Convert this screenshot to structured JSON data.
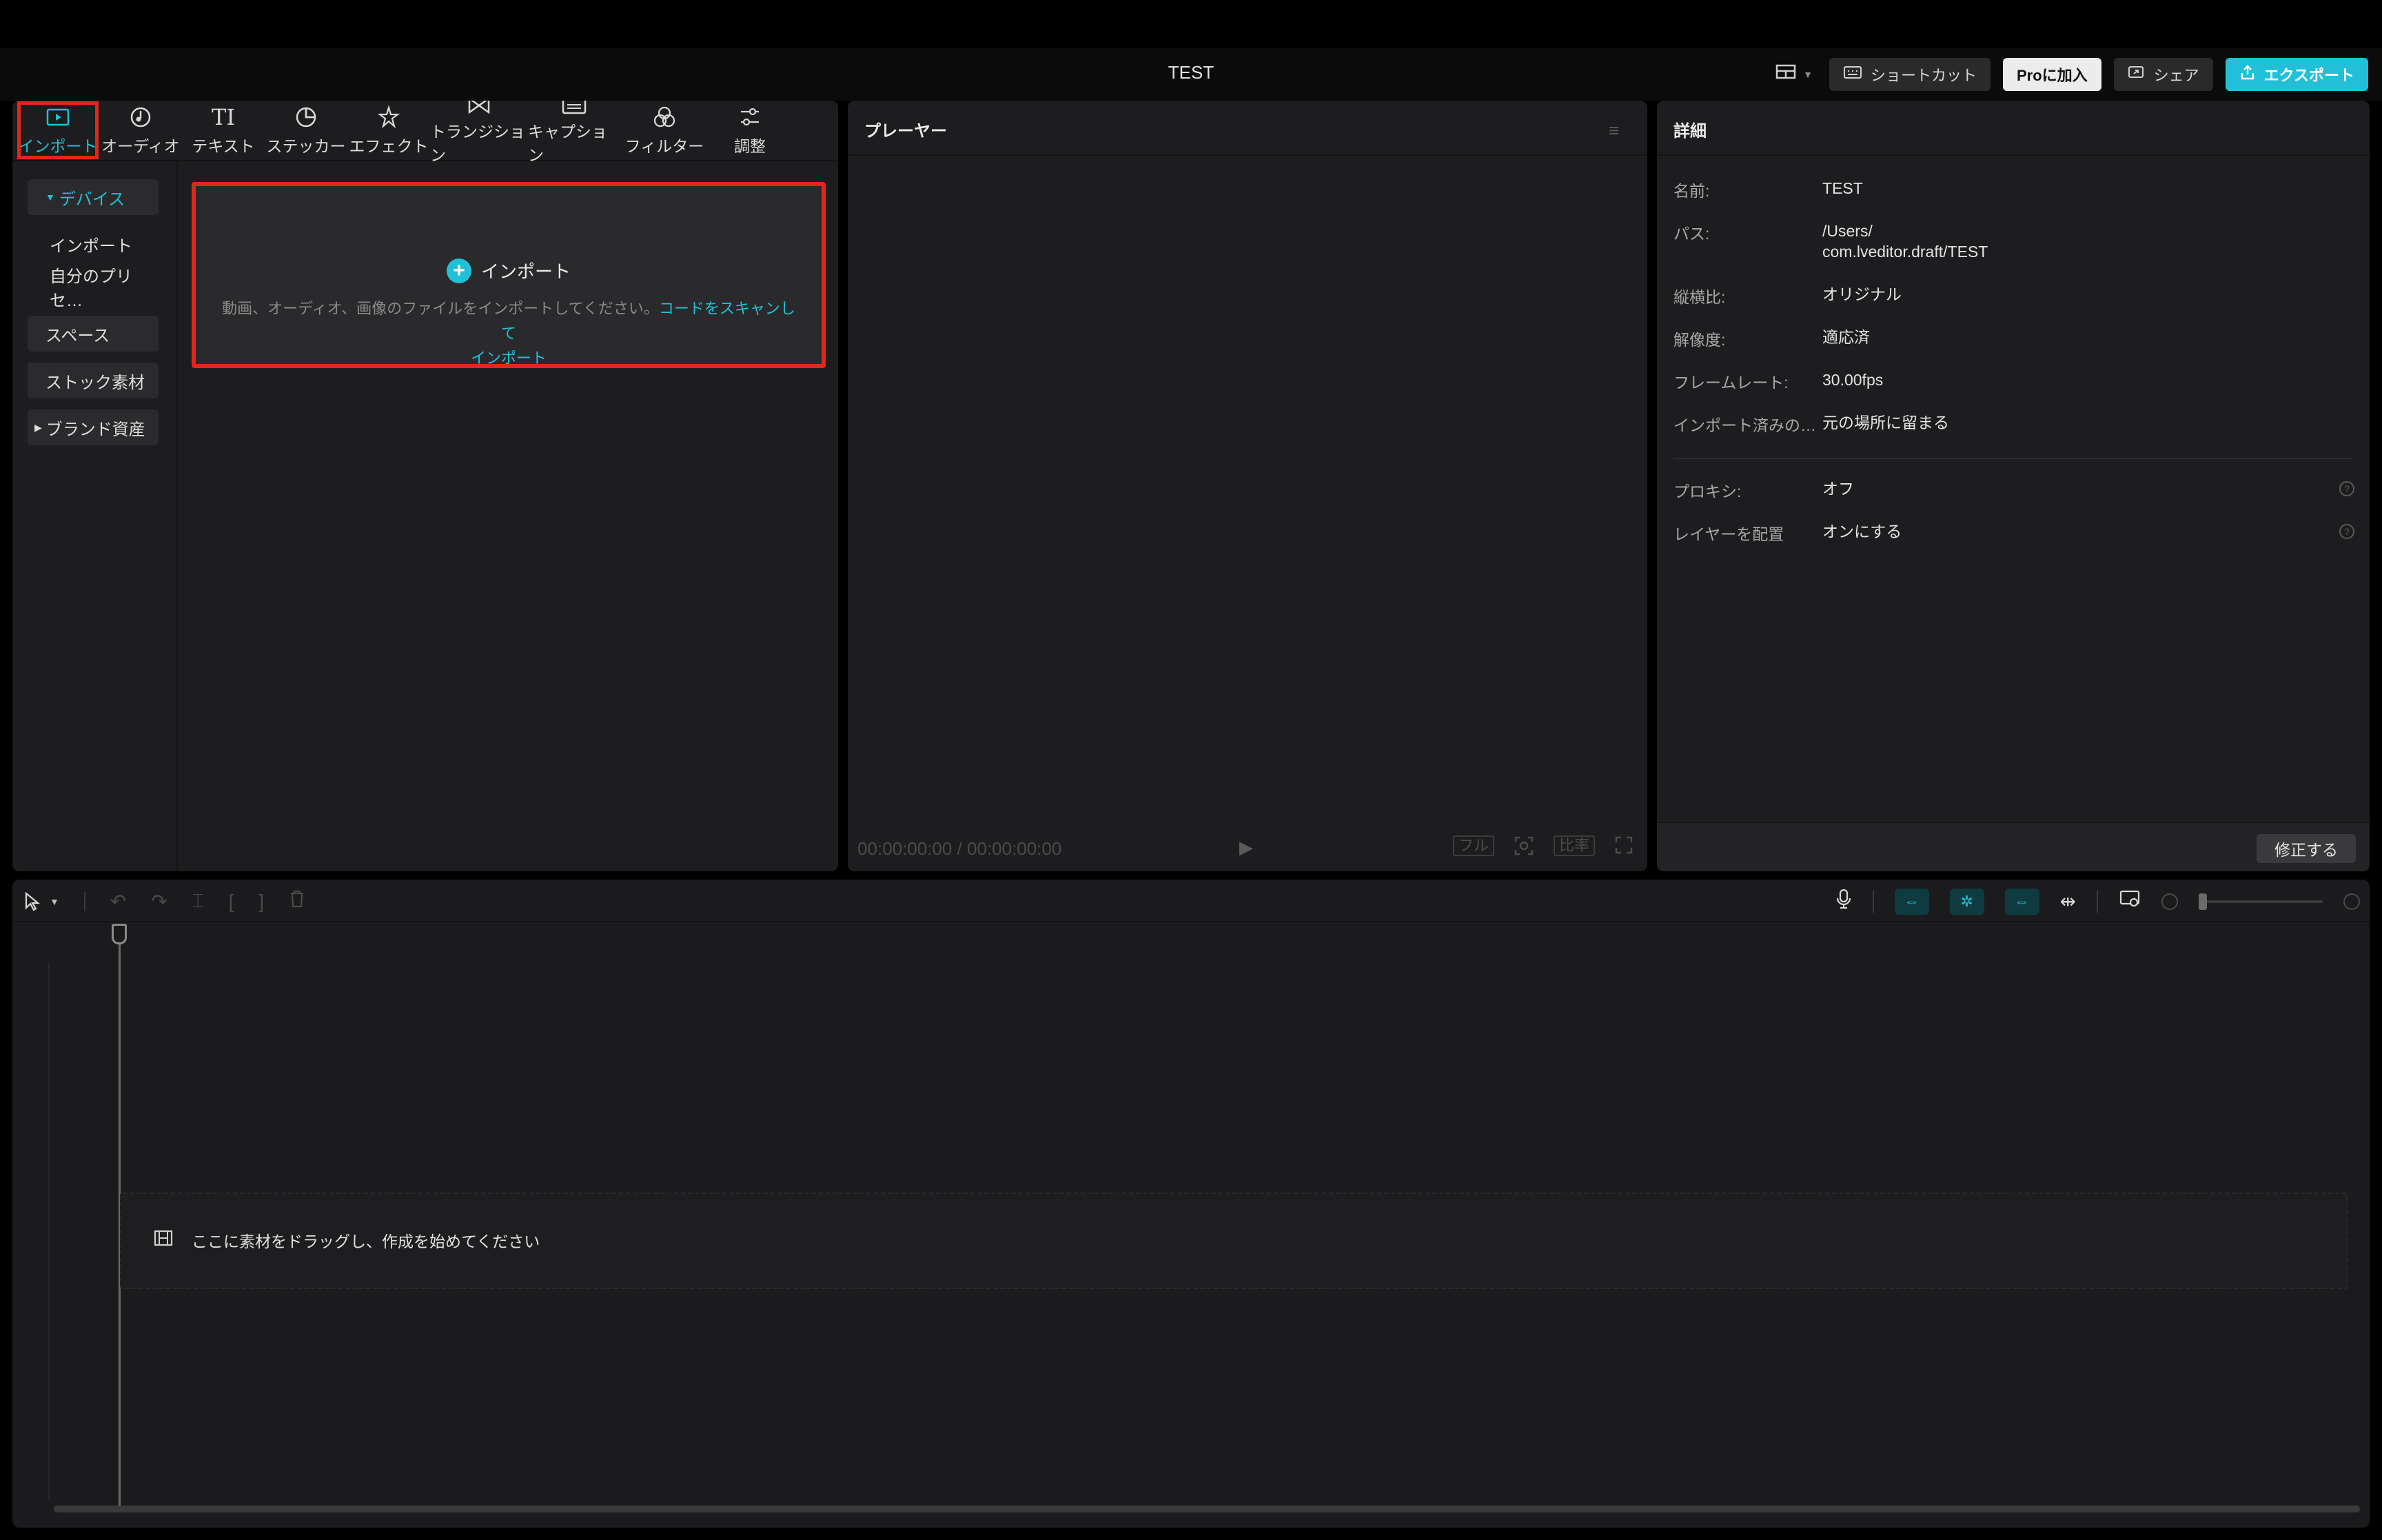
{
  "window": {
    "title": "TEST"
  },
  "topbar": {
    "shortcut_label": "ショートカット",
    "pro_label": "Proに加入",
    "share_label": "シェア",
    "export_label": "エクスポート"
  },
  "tool_tabs": [
    {
      "label": "インポート",
      "icon": "media-import-icon"
    },
    {
      "label": "オーディオ",
      "icon": "audio-icon"
    },
    {
      "label": "テキスト",
      "icon": "text-icon",
      "glyph": "TI"
    },
    {
      "label": "ステッカー",
      "icon": "sticker-icon"
    },
    {
      "label": "エフェクト",
      "icon": "effect-icon"
    },
    {
      "label": "トランジション",
      "icon": "transition-icon"
    },
    {
      "label": "キャプション",
      "icon": "caption-icon"
    },
    {
      "label": "フィルター",
      "icon": "filter-icon"
    },
    {
      "label": "調整",
      "icon": "adjust-icon"
    }
  ],
  "media_sidebar": {
    "device": "デバイス",
    "import": "インポート",
    "my_presets": "自分のプリセ…",
    "space": "スペース",
    "stock": "ストック素材",
    "brand": "ブランド資産"
  },
  "import_zone": {
    "title": "インポート",
    "description": "動画、オーディオ、画像のファイルをインポートしてください。",
    "link_part1": "コードをスキャンして",
    "link_part2": "インポート"
  },
  "player": {
    "title": "プレーヤー",
    "timecode": "00:00:00:00 / 00:00:00:00",
    "btn_full": "フル",
    "btn_ratio": "比率"
  },
  "details": {
    "title": "詳細",
    "rows": [
      {
        "key": "名前:",
        "value": "TEST"
      },
      {
        "key": "パス:",
        "value": "/Users/",
        "value2": "com.lveditor.draft/TEST"
      },
      {
        "key": "縦横比:",
        "value": "オリジナル"
      },
      {
        "key": "解像度:",
        "value": "適応済"
      },
      {
        "key": "フレームレート:",
        "value": "30.00fps"
      },
      {
        "key": "インポート済みの…",
        "value": "元の場所に留まる"
      },
      {
        "key": "プロキシ:",
        "value": "オフ"
      },
      {
        "key": "レイヤーを配置",
        "value": "オンにする"
      }
    ],
    "modify_label": "修正する"
  },
  "timeline": {
    "drop_hint": "ここに素材をドラッグし、作成を始めてください"
  },
  "colors": {
    "accent": "#22c0d8",
    "highlight": "#e0271b",
    "panel": "#1d1d1f"
  }
}
